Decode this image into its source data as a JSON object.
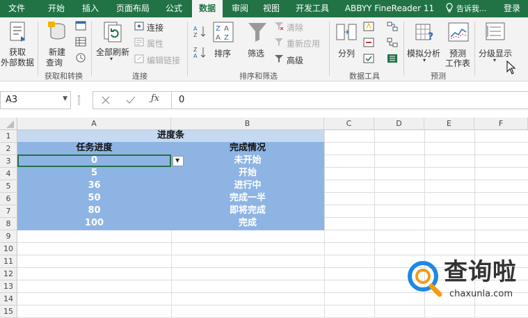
{
  "tabs": [
    {
      "label": "文件",
      "active": false
    },
    {
      "label": "开始",
      "active": false
    },
    {
      "label": "插入",
      "active": false
    },
    {
      "label": "页面布局",
      "active": false
    },
    {
      "label": "公式",
      "active": false
    },
    {
      "label": "数据",
      "active": true
    },
    {
      "label": "审阅",
      "active": false
    },
    {
      "label": "视图",
      "active": false
    },
    {
      "label": "开发工具",
      "active": false
    },
    {
      "label": "ABBYY FineReader 11",
      "active": false
    }
  ],
  "tell_me": "告诉我...",
  "login": "登录",
  "ribbon": {
    "get_external_line1": "获取",
    "get_external_line2": "外部数据",
    "new_query_line1": "新建",
    "new_query_line2": "查询",
    "refresh_all": "全部刷新",
    "connections": "连接",
    "properties": "属性",
    "edit_links": "编辑链接",
    "sort": "排序",
    "filter": "筛选",
    "clear": "清除",
    "reapply": "重新应用",
    "advanced": "高级",
    "text_to_columns": "分列",
    "what_if": "模拟分析",
    "forecast_line1": "预测",
    "forecast_line2": "工作表",
    "outline": "分级显示",
    "groups": {
      "get_transform": "获取和转换",
      "connections": "连接",
      "sort_filter": "排序和筛选",
      "data_tools": "数据工具",
      "forecast": "预测"
    }
  },
  "formula_bar": {
    "name_box": "A3",
    "value": "0"
  },
  "columns": [
    "A",
    "B",
    "C",
    "D",
    "E",
    "F"
  ],
  "rows": [
    "1",
    "2",
    "3",
    "4",
    "5",
    "6",
    "7",
    "8",
    "9",
    "10",
    "11",
    "12",
    "13",
    "14",
    "15"
  ],
  "sheet": {
    "title": "进度条",
    "headers": [
      "任务进度",
      "完成情况"
    ],
    "data": [
      {
        "progress": "0",
        "status": "未开始"
      },
      {
        "progress": "5",
        "status": "开始"
      },
      {
        "progress": "36",
        "status": "进行中"
      },
      {
        "progress": "50",
        "status": "完成一半"
      },
      {
        "progress": "80",
        "status": "即将完成"
      },
      {
        "progress": "100",
        "status": "完成"
      }
    ]
  },
  "watermark": {
    "brand": "查询啦",
    "url": "chaxunla.com"
  }
}
